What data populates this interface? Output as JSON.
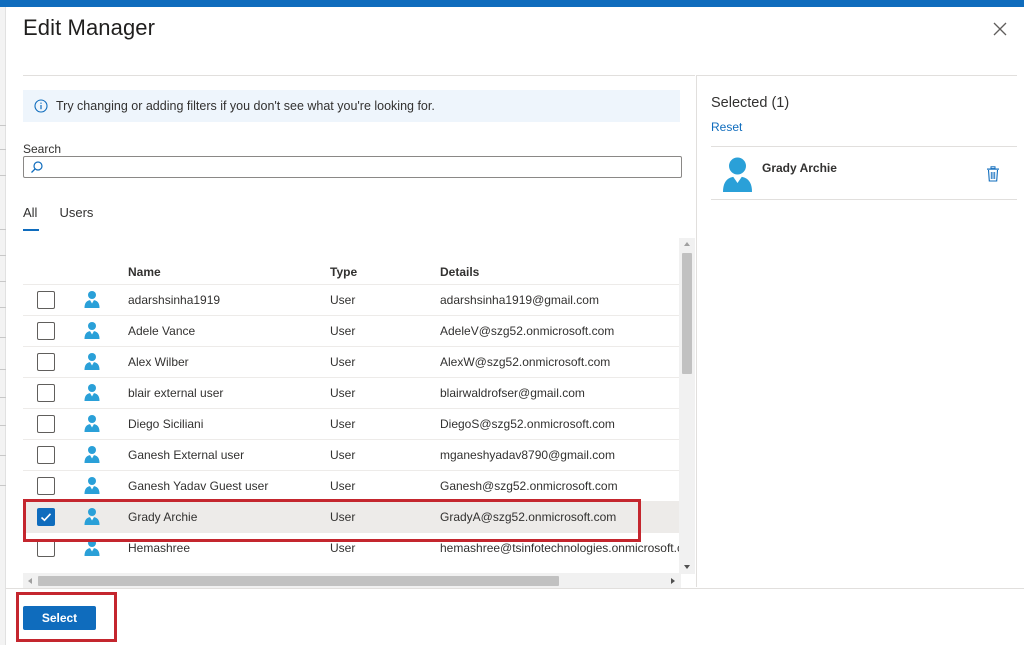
{
  "dialog": {
    "title": "Edit Manager",
    "close_icon": "close-icon"
  },
  "info": {
    "icon": "info-icon",
    "text": "Try changing or adding filters if you don't see what you're looking for."
  },
  "search": {
    "label": "Search",
    "value": "",
    "placeholder": "",
    "icon": "search-icon"
  },
  "tabs": [
    {
      "label": "All",
      "active": true
    },
    {
      "label": "Users",
      "active": false
    }
  ],
  "table": {
    "headers": {
      "name": "Name",
      "type": "Type",
      "details": "Details"
    },
    "rows": [
      {
        "name": "adarshsinha1919",
        "type": "User",
        "details": "adarshsinha1919@gmail.com",
        "checked": false
      },
      {
        "name": "Adele Vance",
        "type": "User",
        "details": "AdeleV@szg52.onmicrosoft.com",
        "checked": false
      },
      {
        "name": "Alex Wilber",
        "type": "User",
        "details": "AlexW@szg52.onmicrosoft.com",
        "checked": false
      },
      {
        "name": "blair external user",
        "type": "User",
        "details": "blairwaldrofser@gmail.com",
        "checked": false
      },
      {
        "name": "Diego Siciliani",
        "type": "User",
        "details": "DiegoS@szg52.onmicrosoft.com",
        "checked": false
      },
      {
        "name": "Ganesh External user",
        "type": "User",
        "details": "mganeshyadav8790@gmail.com",
        "checked": false
      },
      {
        "name": "Ganesh Yadav Guest user",
        "type": "User",
        "details": "Ganesh@szg52.onmicrosoft.com",
        "checked": false
      },
      {
        "name": "Grady Archie",
        "type": "User",
        "details": "GradyA@szg52.onmicrosoft.com",
        "checked": true
      },
      {
        "name": "Hemashree",
        "type": "User",
        "details": "hemashree@tsinfotechnologies.onmicrosoft.co",
        "checked": false
      }
    ]
  },
  "selected_panel": {
    "title": "Selected (1)",
    "reset_label": "Reset",
    "item_name": "Grady Archie",
    "delete_icon": "trash-icon"
  },
  "footer": {
    "select_label": "Select"
  },
  "colors": {
    "accent": "#0f6cbd",
    "highlight": "#c4262e",
    "avatar": "#2aa0d8",
    "info_bg": "#eef5fc"
  }
}
